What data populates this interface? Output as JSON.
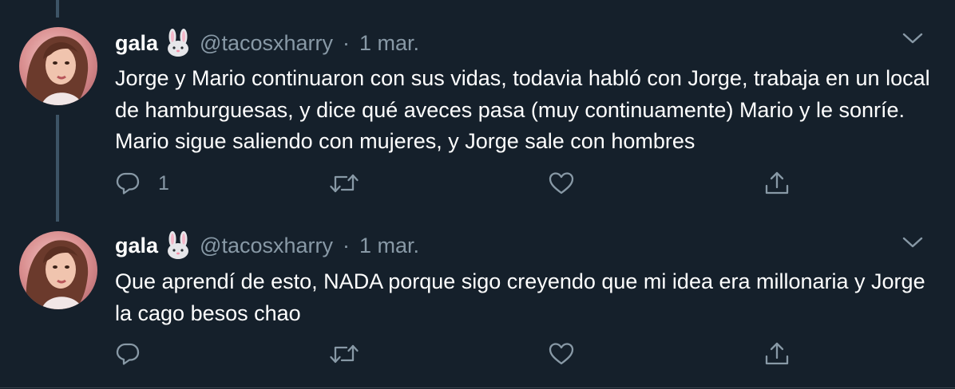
{
  "colors": {
    "background": "#15202b",
    "text": "#ffffff",
    "muted": "#8899a6",
    "thread_line": "#3d5466"
  },
  "tweets": [
    {
      "display_name": "gala",
      "name_emoji": "rabbit-face-emoji",
      "handle": "@tacosxharry",
      "separator": "·",
      "date": "1 mar.",
      "text": "Jorge y Mario continuaron con sus vidas, todavia habló con Jorge, trabaja en un local de hamburguesas, y dice qué aveces pasa (muy continuamente) Mario y le sonríe. Mario sigue saliendo con mujeres, y Jorge sale con hombres",
      "reply_count": "1",
      "actions": [
        "reply-icon",
        "retweet-icon",
        "like-icon",
        "share-icon"
      ]
    },
    {
      "display_name": "gala",
      "name_emoji": "rabbit-face-emoji",
      "handle": "@tacosxharry",
      "separator": "·",
      "date": "1 mar.",
      "text": "Que aprendí de esto, NADA porque sigo creyendo que mi idea era millonaria y Jorge la cago besos chao",
      "reply_count": "",
      "actions": [
        "reply-icon",
        "retweet-icon",
        "like-icon",
        "share-icon"
      ]
    }
  ]
}
